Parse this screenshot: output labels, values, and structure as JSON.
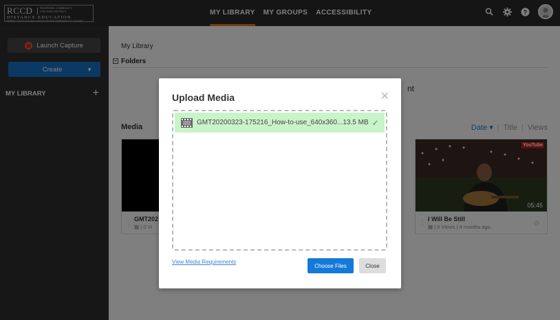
{
  "header": {
    "logo": {
      "main": "RCCD",
      "district": [
        "RIVERSIDE COMMUNITY",
        "COLLEGE DISTRICT"
      ],
      "division": "DISTANCE EDUCATION",
      "colleges": "MORENO VALLEY COLLEGE | NORCO COLLEGE | RIVERSIDE CITY COLLEGE"
    },
    "nav": [
      {
        "label": "MY LIBRARY",
        "active": true
      },
      {
        "label": "MY GROUPS",
        "active": false
      },
      {
        "label": "ACCESSIBILITY",
        "active": false
      }
    ],
    "icons": [
      "search-icon",
      "gear-icon",
      "help-icon",
      "avatar-icon"
    ]
  },
  "sidebar": {
    "capture_label": "Launch Capture",
    "create_label": "Create",
    "section_label": "MY LIBRARY"
  },
  "main": {
    "breadcrumb": "My Library",
    "folders_label": "Folders",
    "partial_text": "nt",
    "media_label": "Media",
    "sort": {
      "active": "Date",
      "options": [
        "Title",
        "Views"
      ]
    },
    "cards": [
      {
        "title": "GMT202",
        "meta": "| 0 Vi"
      },
      {
        "title": "I Will Be Still",
        "meta": "| 5 Views | 4 months ago",
        "duration": "05:45",
        "badge": "YouTube"
      }
    ]
  },
  "modal": {
    "title": "Upload Media",
    "file": {
      "name": "GMT20200323-175216_How-to-use_640x360...",
      "size": "13.5 MB"
    },
    "requirements_link": "View Media Requirements",
    "choose_label": "Choose Files",
    "close_label": "Close"
  },
  "colors": {
    "accent": "#e8791e",
    "primary_button": "#1479d9",
    "upload_success": "#c9f4c9"
  }
}
